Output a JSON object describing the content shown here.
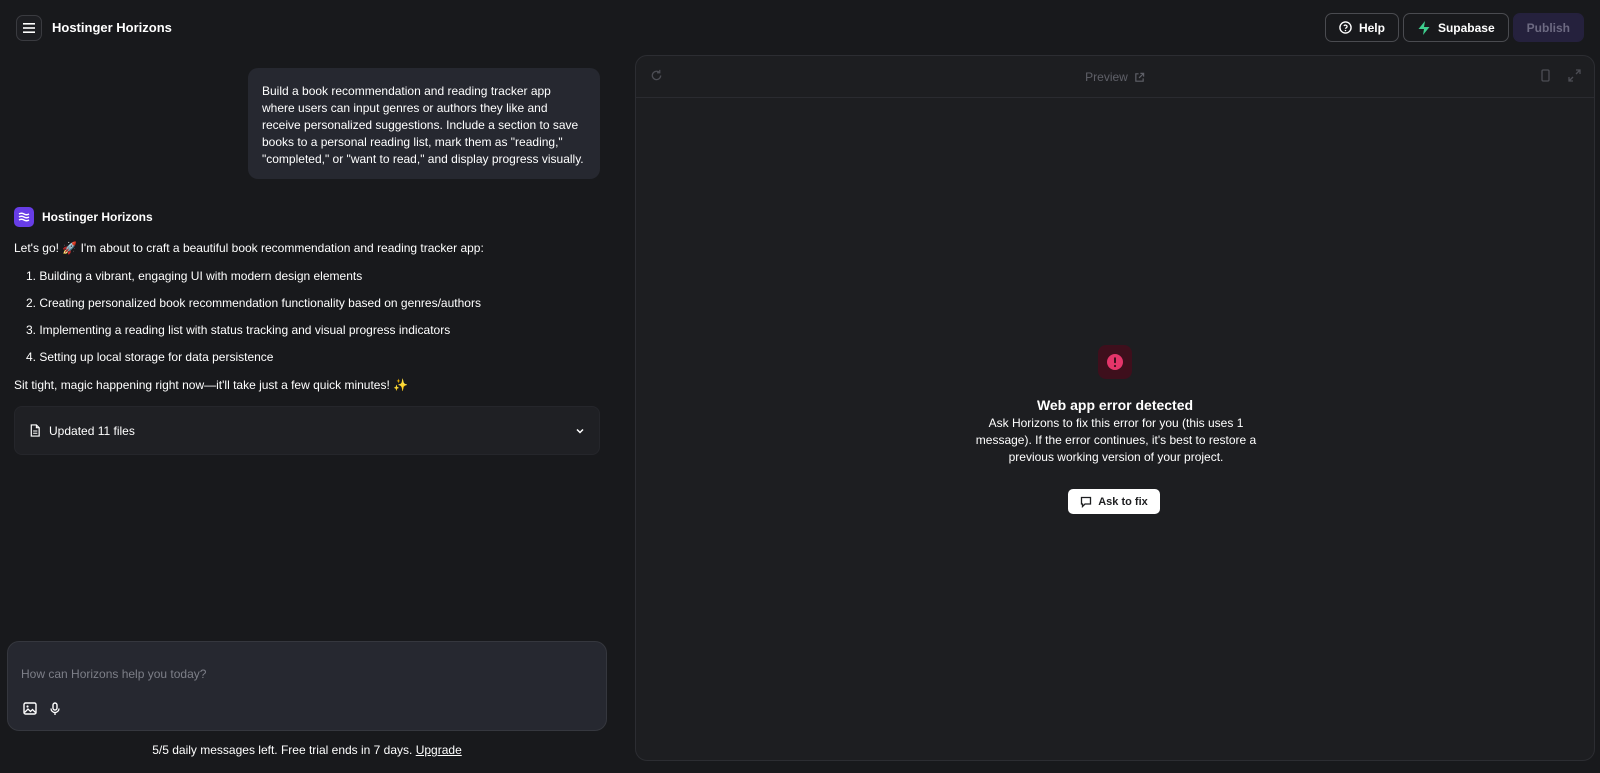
{
  "header": {
    "app_title": "Hostinger Horizons",
    "help_label": "Help",
    "supabase_label": "Supabase",
    "publish_label": "Publish"
  },
  "chat": {
    "user_message": "Build a book recommendation and reading tracker app where users can input genres or authors they like and receive personalized suggestions. Include a section to save books to a personal reading list, mark them as \"reading,\" \"completed,\" or \"want to read,\" and display progress visually.",
    "assistant_name": "Hostinger Horizons",
    "assistant_intro": "Let's go! 🚀 I'm about to craft a beautiful book recommendation and reading tracker app:",
    "steps": [
      "1. Building a vibrant, engaging UI with modern design elements",
      "2. Creating personalized book recommendation functionality based on genres/authors",
      "3. Implementing a reading list with status tracking and visual progress indicators",
      "4. Setting up local storage for data persistence"
    ],
    "assistant_outro": "Sit tight, magic happening right now—it'll take just a few quick minutes! ✨",
    "files_label": "Updated 11 files"
  },
  "composer": {
    "placeholder": "How can Horizons help you today?",
    "footer_text": "5/5 daily messages left. Free trial ends in 7 days.",
    "upgrade_label": "Upgrade"
  },
  "preview": {
    "title": "Preview",
    "error_title": "Web app error detected",
    "error_description": "Ask Horizons to fix this error for you (this uses 1 message). If the error continues, it's best to restore a previous working version of your project.",
    "fix_button_label": "Ask to fix"
  },
  "colors": {
    "background": "#18191c",
    "brand_purple": "#673de6",
    "supabase_green": "#3ecf8e",
    "error_pink": "#e4356a"
  }
}
